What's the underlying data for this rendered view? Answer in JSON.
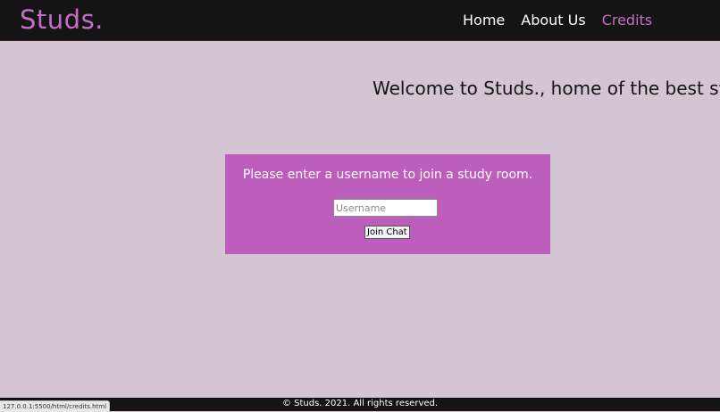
{
  "colors": {
    "background": "#d4c4d4",
    "navbar": "#141414",
    "accent": "#c46fc4",
    "panel": "#bd5ebd"
  },
  "header": {
    "brand": "Studs.",
    "nav": [
      {
        "label": "Home",
        "active": false
      },
      {
        "label": "About Us",
        "active": false
      },
      {
        "label": "Credits",
        "active": true
      }
    ]
  },
  "main": {
    "marquee": "Welcome to Studs., home of the best st",
    "join": {
      "prompt": "Please enter a username to join a study room.",
      "username_placeholder": "Username",
      "username_value": "",
      "button_label": "Join Chat"
    }
  },
  "footer": {
    "text": "© Studs. 2021. All rights reserved."
  },
  "status_bar": {
    "url": "127.0.0.1:5500/html/credits.html"
  }
}
